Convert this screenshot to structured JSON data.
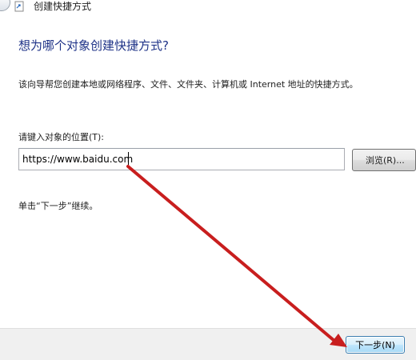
{
  "window": {
    "title": "创建快捷方式"
  },
  "wizard": {
    "heading": "想为哪个对象创建快捷方式?",
    "description": "该向导帮您创建本地或网络程序、文件、文件夹、计算机或 Internet 地址的快捷方式。",
    "location_label": "请键入对象的位置(T):",
    "location_value": "https://www.baidu.com",
    "browse_label": "浏览(R)...",
    "continue_hint": "单击“下一步”继续。"
  },
  "footer": {
    "next_label": "下一步(N)"
  },
  "icons": {
    "back": "back-arrow-icon",
    "app": "shortcut-wizard-icon"
  },
  "colors": {
    "heading": "#1e3287",
    "annotation_arrow": "#c81e1e",
    "footer_bg": "#f0f0f0",
    "next_button_border": "#3c7fb1"
  }
}
